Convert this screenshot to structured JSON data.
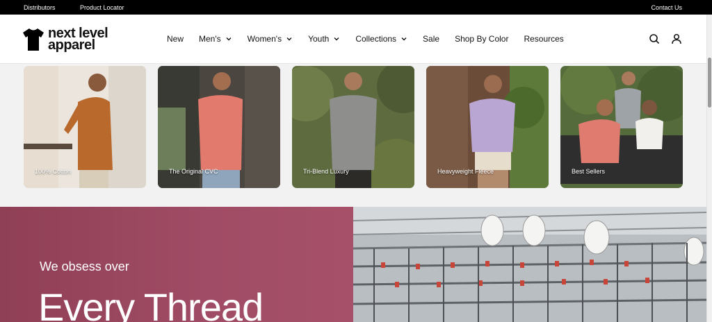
{
  "topbar": {
    "distributors": "Distributors",
    "product_locator": "Product Locator",
    "contact": "Contact Us"
  },
  "brand": {
    "logo_line1": "next level",
    "logo_line2": "apparel",
    "logo_icon": "tshirt-icon"
  },
  "nav": {
    "items": [
      {
        "label": "New",
        "dropdown": false
      },
      {
        "label": "Men's",
        "dropdown": true
      },
      {
        "label": "Women's",
        "dropdown": true
      },
      {
        "label": "Youth",
        "dropdown": true
      },
      {
        "label": "Collections",
        "dropdown": true
      },
      {
        "label": "Sale",
        "dropdown": false
      },
      {
        "label": "Shop By Color",
        "dropdown": false
      },
      {
        "label": "Resources",
        "dropdown": false
      }
    ],
    "icons": [
      "search-icon",
      "account-icon"
    ]
  },
  "categories": [
    {
      "label": "100% Cotton",
      "shirt_color": "#b8692b"
    },
    {
      "label": "The Original CVC",
      "shirt_color": "#e27a6d"
    },
    {
      "label": "Tri-Blend Luxury",
      "shirt_color": "#8e8e8c"
    },
    {
      "label": "Heavyweight Fleece",
      "shirt_color": "#b9a6d3"
    },
    {
      "label": "Best Sellers",
      "shirt_color": "#e07b70"
    }
  ],
  "hero": {
    "kicker": "We obsess over",
    "headline": "Every Thread",
    "accent_color": "#a14c66"
  }
}
